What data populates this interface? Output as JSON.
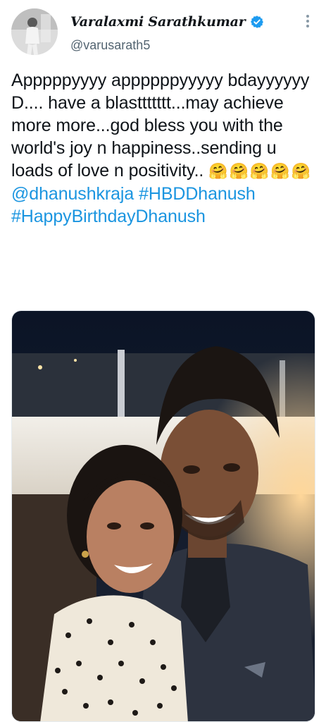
{
  "tweet": {
    "author": {
      "display_name": "Varalaxmi Sarathkumar",
      "handle": "@varusarath5",
      "verified": true,
      "avatar_icon": "user-avatar"
    },
    "text_main": "Apppppyyyy appppppyyyyy bdayyyyyy D.... have a blasttttttt...may achieve more more...god bless you with the world's joy n happiness..sending u loads of love n positivity..",
    "text_emojis": "🤗🤗🤗🤗🤗",
    "mention": "@dhanushkraja",
    "hashtags": [
      "#HBDDhanush",
      "#HappyBirthdayDhanush"
    ],
    "media_alt": "Selfie photo of two smiling people at night on a rooftop"
  },
  "colors": {
    "link": "#1b95e0",
    "verified_badge": "#1d9bf0",
    "secondary_text": "#536471"
  },
  "icons": {
    "more": "more-vertical-icon",
    "verified": "verified-badge-icon"
  }
}
